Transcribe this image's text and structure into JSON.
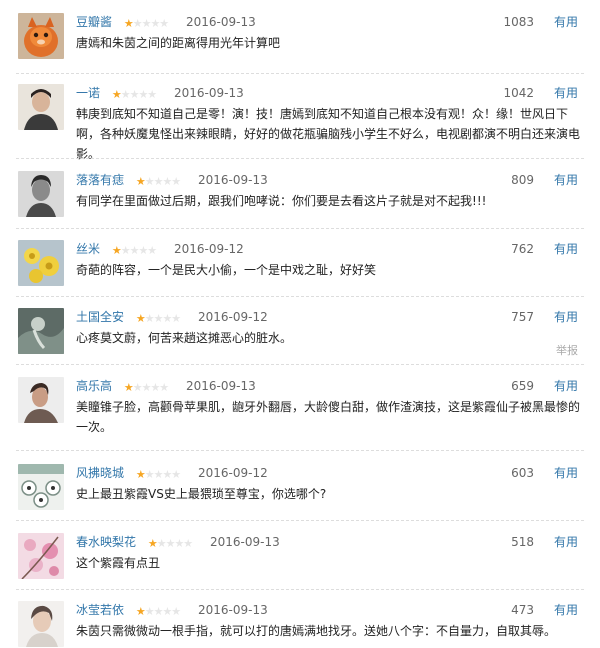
{
  "useful_label": "有用",
  "report_label": "举报",
  "colors": {
    "link": "#3377aa",
    "star_filled": "#f6a623",
    "star_empty": "#e6e6e6"
  },
  "comments": [
    {
      "user": "豆瓣酱",
      "rating": 1,
      "date": "2016-09-13",
      "votes": "1083",
      "text": "唐嫣和朱茵之间的距离得用光年计算吧",
      "avatar": "orange-cat-avatar"
    },
    {
      "user": "一诺",
      "rating": 1,
      "date": "2016-09-13",
      "votes": "1042",
      "text": "韩庚到底知不知道自己是零！演！技！唐嫣到底知不知道自己根本没有观！众！缘！世风日下啊，各种妖魔鬼怪出来辣眼睛，好好的做花瓶骗脑残小学生不好么，电视剧都演不明白还来演电影。",
      "avatar": "portrait-avatar"
    },
    {
      "user": "落落有痣",
      "rating": 1,
      "date": "2016-09-13",
      "votes": "809",
      "text": "有同学在里面做过后期，跟我们咆哮说：你们要是去看这片子就是对不起我!!!",
      "avatar": "bw-portrait-avatar"
    },
    {
      "user": "丝米",
      "rating": 1,
      "date": "2016-09-12",
      "votes": "762",
      "text": "奇葩的阵容，一个是民大小偷，一个是中戏之耻，好好笑",
      "avatar": "flowers-avatar"
    },
    {
      "user": "土国全安",
      "rating": 1,
      "date": "2016-09-12",
      "votes": "757",
      "text": "心疼莫文蔚，何苦来趟这摊恶心的脏水。",
      "avatar": "abstract-avatar",
      "show_report": true
    },
    {
      "user": "高乐高",
      "rating": 1,
      "date": "2016-09-13",
      "votes": "659",
      "text": "美瞳锥子脸，高颧骨苹果肌，龅牙外翻唇，大龄傻白甜，做作渣演技，这是紫霞仙子被黑最惨的一次。",
      "avatar": "profile-avatar"
    },
    {
      "user": "风拂晓城",
      "rating": 1,
      "date": "2016-09-12",
      "votes": "603",
      "text": "史上最丑紫霞VS史上最猥琐至尊宝，你选哪个?",
      "avatar": "grid-cartoon-avatar"
    },
    {
      "user": "春水映梨花",
      "rating": 1,
      "date": "2016-09-13",
      "votes": "518",
      "text": "这个紫霞有点丑",
      "avatar": "pink-blossom-avatar"
    },
    {
      "user": "冰莹若依",
      "rating": 1,
      "date": "2016-09-13",
      "votes": "473",
      "text": "朱茵只需微微动一根手指，就可以打的唐嫣满地找牙。送她八个字：不自量力，自取其辱。",
      "avatar": "light-portrait-avatar"
    }
  ]
}
